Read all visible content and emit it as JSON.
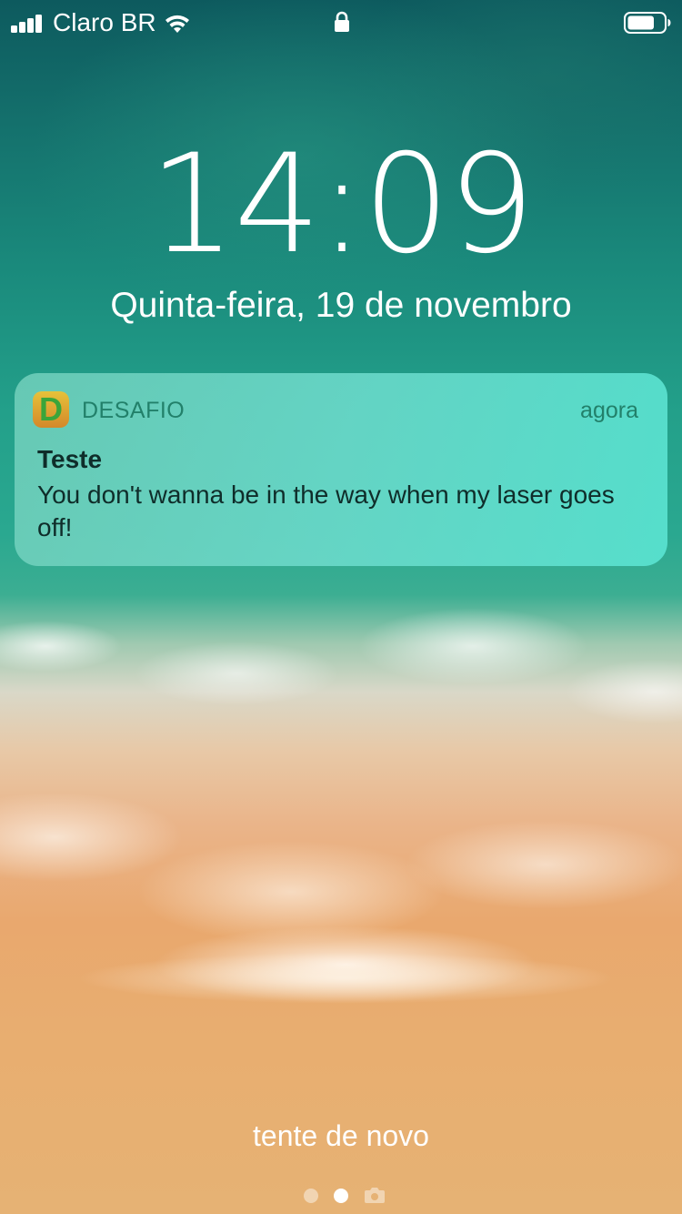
{
  "status_bar": {
    "carrier": "Claro BR",
    "signal_icon": "signal-bars-icon",
    "wifi_icon": "wifi-icon",
    "lock_icon": "lock-icon",
    "battery_icon": "battery-icon",
    "battery_level": 0.75
  },
  "lock_screen": {
    "time": "14:09",
    "date": "Quinta-feira, 19 de novembro"
  },
  "notification": {
    "app_icon_letter": "D",
    "app_name": "DESAFIO",
    "time": "agora",
    "title": "Teste",
    "body": "You don't wanna be in the way when my laser goes off!"
  },
  "bottom": {
    "retry_text": "tente de novo",
    "page_indicator": {
      "pages": 3,
      "current_page": 2,
      "last_page_icon": "camera-icon"
    }
  },
  "colors": {
    "notification_accent": "#22806a",
    "text_dark": "#0f2d2a",
    "white": "#ffffff"
  }
}
